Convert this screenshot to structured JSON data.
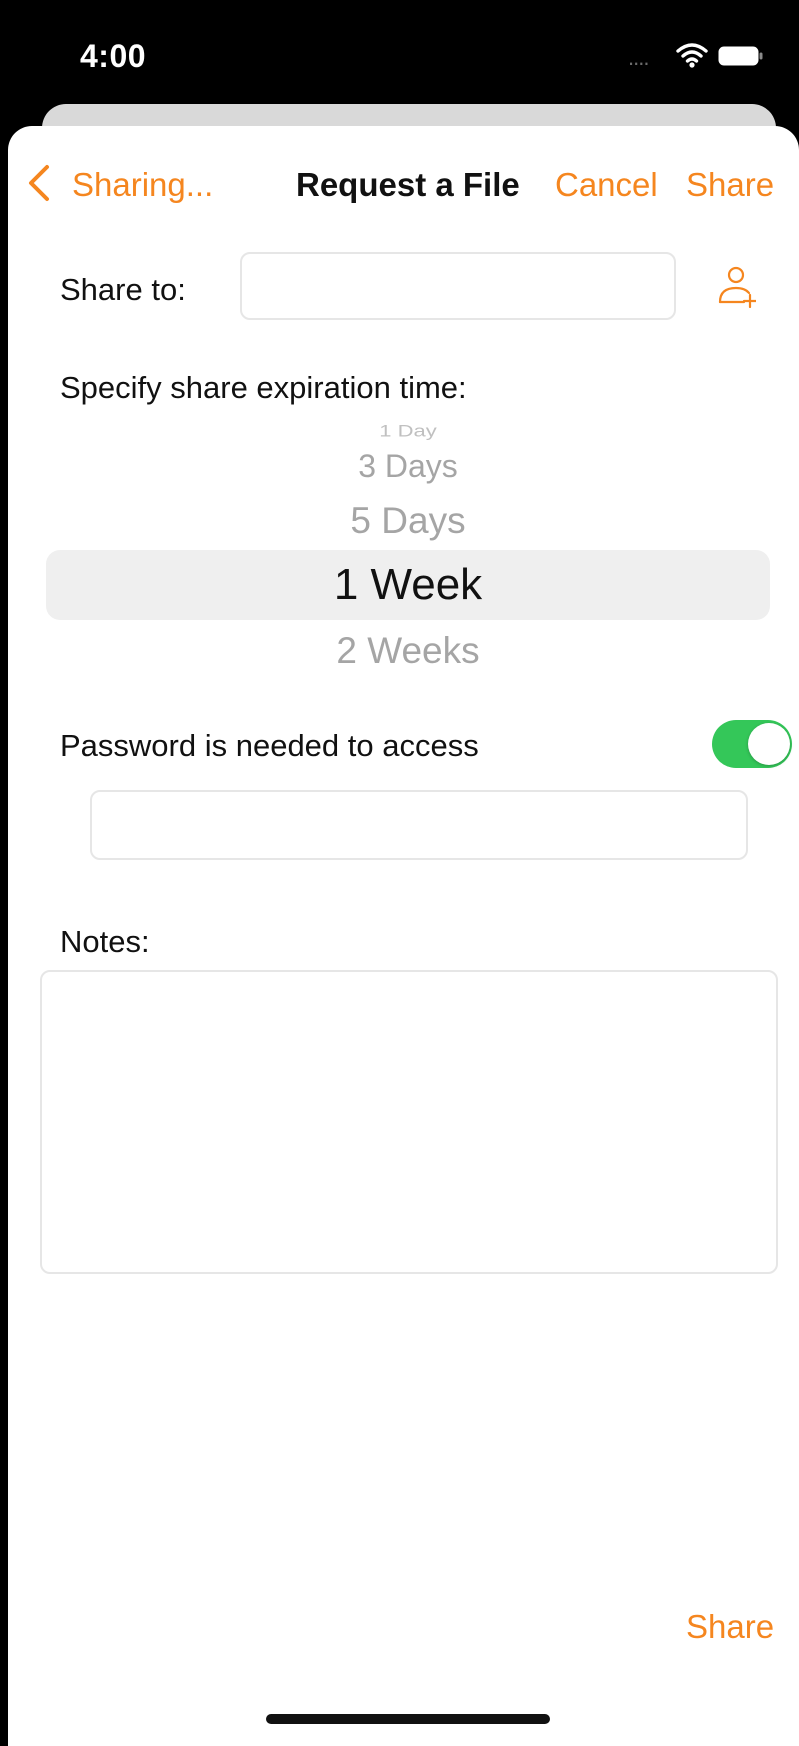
{
  "status_bar": {
    "time": "4:00",
    "signal": "....",
    "icons": [
      "wifi-icon",
      "battery-icon"
    ]
  },
  "nav": {
    "back_label": "Sharing...",
    "title": "Request a File",
    "cancel_label": "Cancel",
    "share_label": "Share"
  },
  "form": {
    "share_to_label": "Share to:",
    "share_to_value": "",
    "expiry_label": "Specify share expiration time:",
    "expiry_options": [
      "1 Day",
      "3 Days",
      "5 Days",
      "1 Week",
      "2 Weeks"
    ],
    "expiry_selected": "1 Week",
    "password_label": "Password is needed to access",
    "password_enabled": true,
    "password_value": "",
    "notes_label": "Notes:",
    "notes_value": ""
  },
  "footer": {
    "share_label": "Share"
  },
  "colors": {
    "accent": "#f5861f",
    "toggle_on": "#34c759",
    "text": "#111111",
    "picker_inactive": "#a5a5a5"
  }
}
